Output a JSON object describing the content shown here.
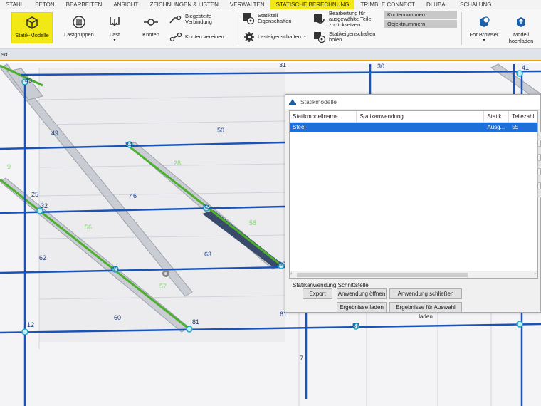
{
  "tabs": [
    {
      "label": "STAHL",
      "active": false
    },
    {
      "label": "BETON",
      "active": false
    },
    {
      "label": "BEARBEITEN",
      "active": false
    },
    {
      "label": "ANSICHT",
      "active": false
    },
    {
      "label": "ZEICHNUNGEN & LISTEN",
      "active": false
    },
    {
      "label": "VERWALTEN",
      "active": false
    },
    {
      "label": "STATISCHE BERECHNUNG",
      "active": true
    },
    {
      "label": "TRIMBLE CONNECT",
      "active": false
    },
    {
      "label": "DLUBAL",
      "active": false
    },
    {
      "label": "SCHALUNG",
      "active": false
    }
  ],
  "ribbon": {
    "statik_modelle": "Statik-Modelle",
    "lastgruppen": "Lastgruppen",
    "last": "Last",
    "knoten": "Knoten",
    "biegesteife": "Biegesteife Verbindung",
    "knoten_vereinen": "Knoten vereinen",
    "statikteil": "Statikteil Eigenschaften",
    "lasteigenschaften": "Lasteigenschaften",
    "bearbeitung": "Bearbeitung für ausgewählte Teile zurücksetzen",
    "statikeigenschaften": "Statikeigenschaften holen",
    "knotennummern": "Knotennummern",
    "objektnummern": "Objektnummern",
    "for_browser": "For Browser",
    "modell_hochladen": "Modell hochladen"
  },
  "strip": {
    "label": "so"
  },
  "viewport": {
    "labels": [
      {
        "text": "31",
        "kind": "member"
      },
      {
        "text": "30",
        "kind": "member"
      },
      {
        "text": "49",
        "kind": "node"
      },
      {
        "text": "41",
        "kind": "node"
      },
      {
        "text": "49",
        "kind": "member"
      },
      {
        "text": "50",
        "kind": "member"
      },
      {
        "text": "84",
        "kind": "node"
      },
      {
        "text": "28",
        "kind": "green"
      },
      {
        "text": "9",
        "kind": "green"
      },
      {
        "text": "25",
        "kind": "member"
      },
      {
        "text": "32",
        "kind": "node"
      },
      {
        "text": "46",
        "kind": "member"
      },
      {
        "text": "34",
        "kind": "node"
      },
      {
        "text": "56",
        "kind": "green"
      },
      {
        "text": "58",
        "kind": "green"
      },
      {
        "text": "62",
        "kind": "member"
      },
      {
        "text": "63",
        "kind": "member"
      },
      {
        "text": "85",
        "kind": "node"
      },
      {
        "text": "86",
        "kind": "node"
      },
      {
        "text": "57",
        "kind": "green"
      },
      {
        "text": "60",
        "kind": "member"
      },
      {
        "text": "61",
        "kind": "member"
      },
      {
        "text": "12",
        "kind": "node"
      },
      {
        "text": "81",
        "kind": "node"
      },
      {
        "text": "87",
        "kind": "node"
      },
      {
        "text": "7",
        "kind": "member"
      }
    ]
  },
  "dialog": {
    "title": "Statikmodelle",
    "columns": [
      "Statikmodellname",
      "Statikanwendung",
      "Statik...",
      "Teilezahl"
    ],
    "rows": [
      {
        "name": "Steel",
        "application": "",
        "status": "Ausg...",
        "parts": "55"
      }
    ],
    "section_label": "Statikanwendung Schnittstelle",
    "buttons": {
      "export": "Export",
      "open": "Anwendung öffnen",
      "close": "Anwendung schließen",
      "load_results": "Ergebnisse laden",
      "load_results_selection": "Ergebnisse für Auswahl laden"
    }
  },
  "colors": {
    "accent_yellow": "#f2e816",
    "member_blue": "#1a53b8",
    "beam_green": "#4caf2d",
    "node_cyan": "#1aa6c8",
    "selection_blue": "#1e6fd9"
  }
}
